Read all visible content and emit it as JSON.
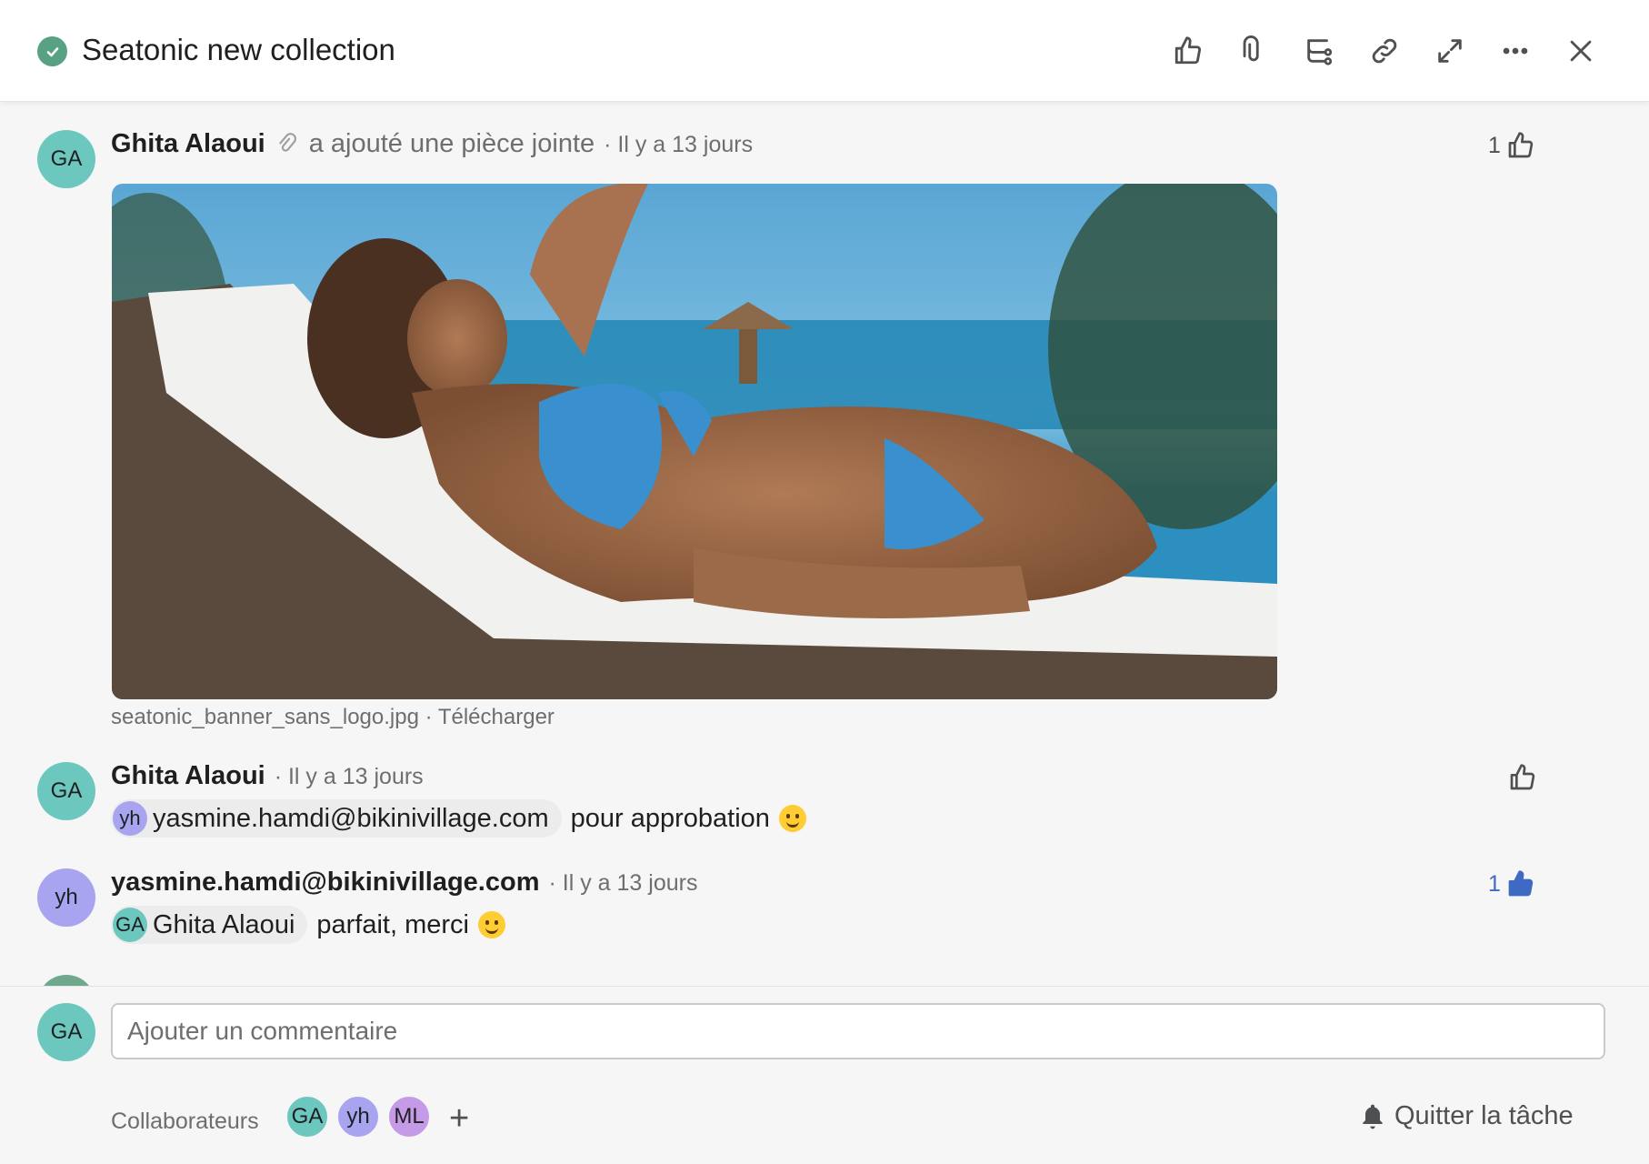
{
  "header": {
    "title": "Seatonic new collection",
    "status_color": "#58a182",
    "actions": [
      "thumbs-up-icon",
      "paperclip-icon",
      "subtask-icon",
      "link-icon",
      "expand-icon",
      "more-icon",
      "close-icon"
    ]
  },
  "stories": [
    {
      "author": "Ghita Alaoui",
      "initials": "GA",
      "action": "a ajouté une pièce jointe",
      "time": "· Il y a 13 jours",
      "likes": "1",
      "attachment": {
        "filename": "seatonic_banner_sans_logo.jpg",
        "separator": " · ",
        "download": "Télécharger"
      }
    },
    {
      "author": "Ghita Alaoui",
      "initials": "GA",
      "time": "· Il y a 13 jours",
      "mention_initials": "yh",
      "mention_name": "yasmine.hamdi@bikinivillage.com",
      "text": "pour approbation"
    },
    {
      "author": "yasmine.hamdi@bikinivillage.com",
      "initials": "yh",
      "time": "· Il y a 13 jours",
      "likes": "1",
      "mention_initials": "GA",
      "mention_name": "Ghita Alaoui",
      "text": "parfait, merci"
    }
  ],
  "composer": {
    "initials": "GA",
    "placeholder": "Ajouter un commentaire",
    "collaborators_label": "Collaborateurs",
    "collaborators": [
      "GA",
      "yh",
      "ML"
    ],
    "add": "+",
    "leave_label": "Quitter la tâche"
  },
  "colors": {
    "accent_like": "#3f6ac4",
    "avatar_ga": "#6cc8be",
    "avatar_yh": "#a8a4ef",
    "avatar_ml": "#c59ae6"
  }
}
